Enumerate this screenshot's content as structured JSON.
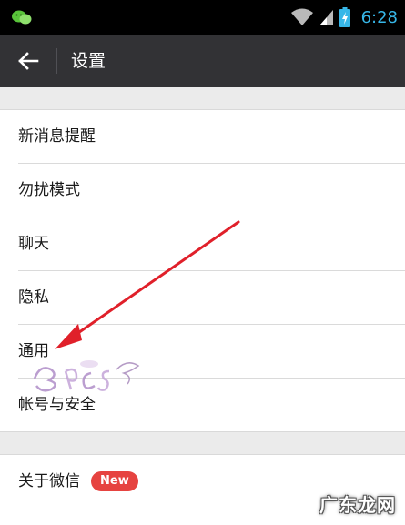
{
  "status_bar": {
    "time": "6:28",
    "icons": [
      "wechat-icon",
      "wifi-icon",
      "signal-icon",
      "battery-icon"
    ]
  },
  "app_bar": {
    "back_icon": "back-arrow-icon",
    "title": "设置"
  },
  "settings": {
    "group1": [
      {
        "label": "新消息提醒"
      },
      {
        "label": "勿扰模式"
      },
      {
        "label": "聊天"
      },
      {
        "label": "隐私"
      },
      {
        "label": "通用"
      },
      {
        "label": "帐号与安全"
      }
    ],
    "group2": [
      {
        "label": "关于微信",
        "badge": "New"
      }
    ]
  },
  "watermark": {
    "site": "广东龙网"
  },
  "colors": {
    "status_bar": "#000000",
    "app_bar": "#323235",
    "time": "#37b7e8",
    "badge": "#e64340",
    "annotation_arrow": "#e0202a",
    "background_gap": "#ebebeb"
  }
}
